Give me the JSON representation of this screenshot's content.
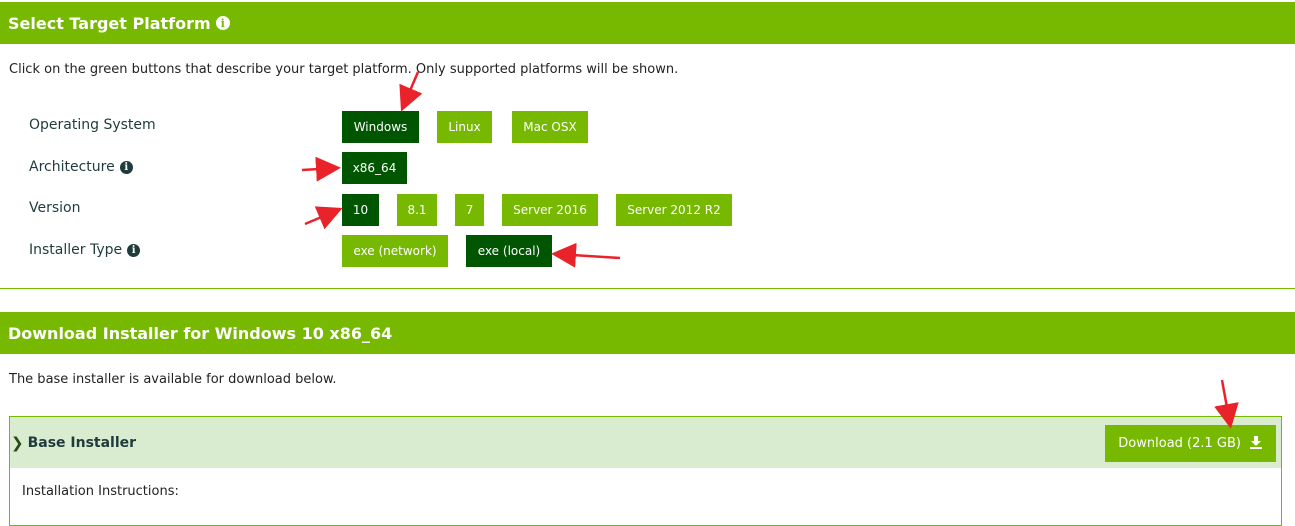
{
  "section1": {
    "title": "Select Target Platform",
    "intro": "Click on the green buttons that describe your target platform. Only supported platforms will be shown."
  },
  "rows": {
    "os": {
      "label": "Operating System",
      "options": [
        "Windows",
        "Linux",
        "Mac OSX"
      ],
      "selected": "Windows"
    },
    "arch": {
      "label": "Architecture",
      "options": [
        "x86_64"
      ],
      "selected": "x86_64"
    },
    "version": {
      "label": "Version",
      "options": [
        "10",
        "8.1",
        "7",
        "Server 2016",
        "Server 2012 R2"
      ],
      "selected": "10"
    },
    "installer": {
      "label": "Installer Type",
      "options": [
        "exe (network)",
        "exe (local)"
      ],
      "selected": "exe (local)"
    }
  },
  "section2": {
    "title": "Download Installer for Windows 10 x86_64",
    "note": "The base installer is available for download below."
  },
  "panel": {
    "title": "Base Installer",
    "download_label": "Download (2.1 GB)",
    "instructions": "Installation Instructions:"
  },
  "icons": {
    "info": "info-circle-icon",
    "chevron": "chevron-right-icon",
    "download": "download-icon"
  },
  "colors": {
    "accent": "#76b900",
    "selected": "#005600",
    "panel_bg": "#d9ecd0",
    "annotation": "#e8232a"
  }
}
